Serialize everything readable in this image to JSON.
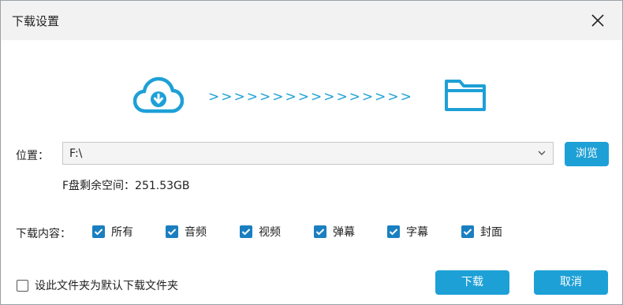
{
  "window": {
    "title": "下载设置"
  },
  "illustration": {
    "arrows": ">>>>>>>>>>>>>>>>"
  },
  "location": {
    "label": "位置：",
    "selected_path": "F:\\",
    "free_space": "F盘剩余空间：251.53GB",
    "browse_label": "浏览"
  },
  "content": {
    "label": "下载内容：",
    "options": [
      {
        "label": "所有",
        "checked": true
      },
      {
        "label": "音频",
        "checked": true
      },
      {
        "label": "视频",
        "checked": true
      },
      {
        "label": "弹幕",
        "checked": true
      },
      {
        "label": "字幕",
        "checked": true
      },
      {
        "label": "封面",
        "checked": true
      }
    ]
  },
  "footer": {
    "default_folder_label": "设此文件夹为默认下载文件夹",
    "default_folder_checked": false,
    "download_label": "下载",
    "cancel_label": "取消"
  },
  "colors": {
    "accent": "#1da0d6",
    "checkbox": "#1a7fc1"
  }
}
